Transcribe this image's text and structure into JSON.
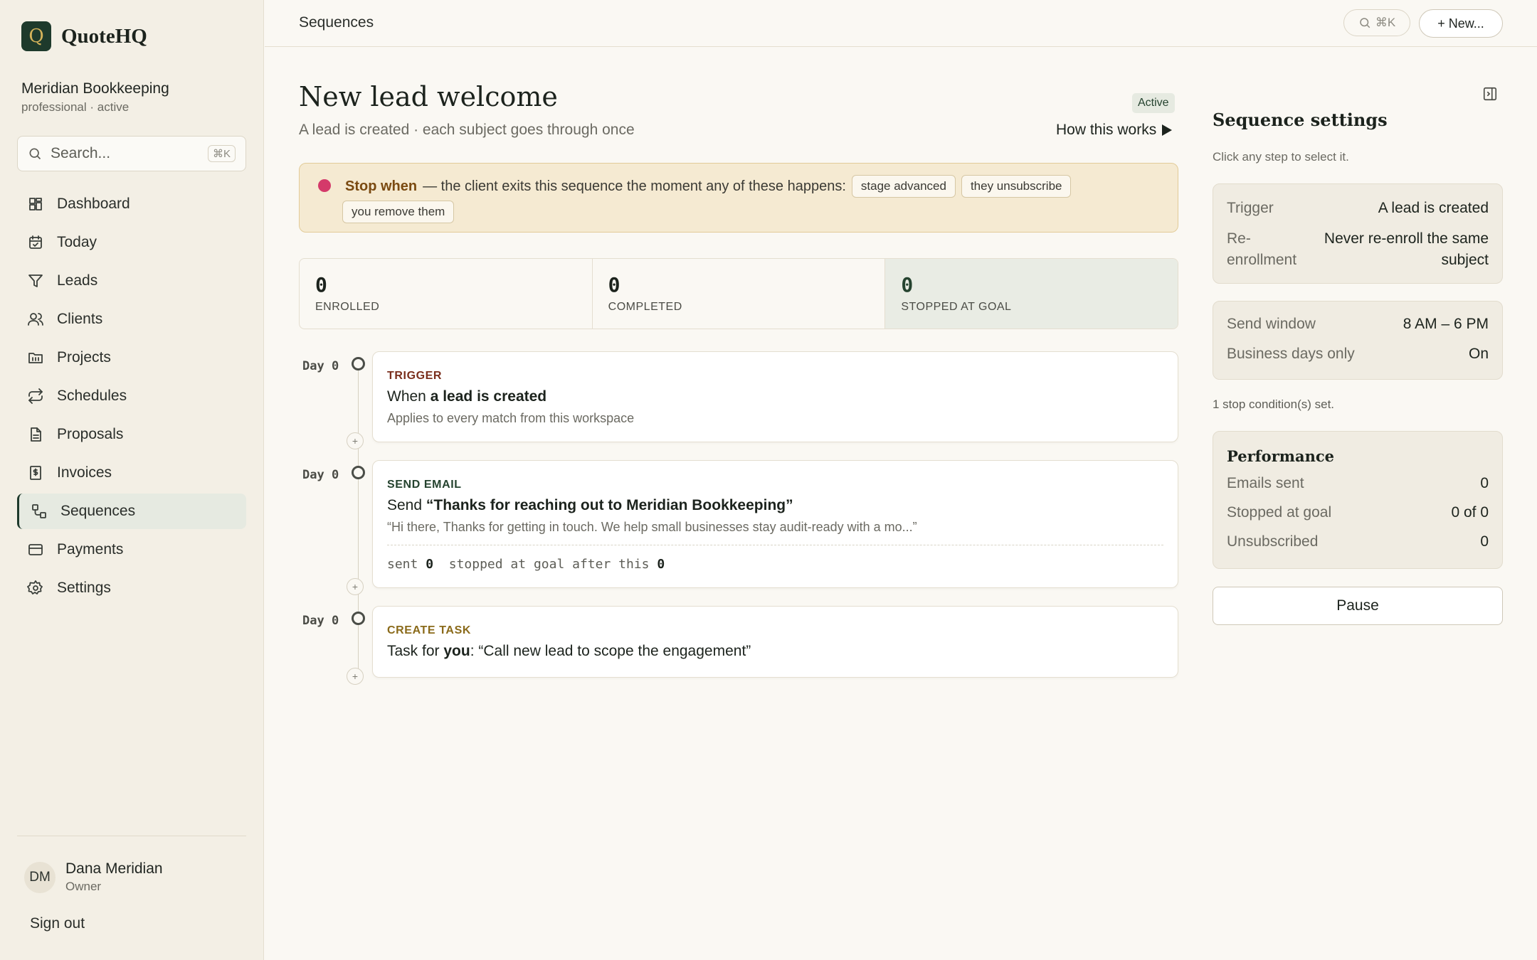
{
  "app": {
    "logo_letter": "Q",
    "name": "QuoteHQ"
  },
  "workspace": {
    "name": "Meridian Bookkeeping",
    "meta": "professional · active"
  },
  "sidebar": {
    "search_placeholder": "Search...",
    "search_shortcut": "⌘K",
    "items": [
      {
        "label": "Dashboard",
        "icon": "dashboard-icon"
      },
      {
        "label": "Today",
        "icon": "calendar-icon"
      },
      {
        "label": "Leads",
        "icon": "funnel-icon"
      },
      {
        "label": "Clients",
        "icon": "users-icon"
      },
      {
        "label": "Projects",
        "icon": "folder-icon"
      },
      {
        "label": "Schedules",
        "icon": "repeat-icon"
      },
      {
        "label": "Proposals",
        "icon": "document-icon"
      },
      {
        "label": "Invoices",
        "icon": "invoice-icon"
      },
      {
        "label": "Sequences",
        "icon": "sequence-icon",
        "active": true
      },
      {
        "label": "Payments",
        "icon": "card-icon"
      },
      {
        "label": "Settings",
        "icon": "gear-icon"
      }
    ],
    "user": {
      "initials": "DM",
      "name": "Dana Meridian",
      "role": "Owner"
    },
    "sign_out": "Sign out"
  },
  "topbar": {
    "breadcrumb": "Sequences",
    "search_shortcut": "⌘K",
    "new_label": "+ New..."
  },
  "sequence": {
    "title": "New lead welcome",
    "subtitle": "A lead is created · each subject goes through once",
    "status": "Active",
    "how_link": "How this works",
    "stop": {
      "label": "Stop when",
      "text": "— the client exits this sequence the moment any of these happens:",
      "conditions": [
        "stage advanced",
        "they unsubscribe",
        "you remove them"
      ]
    },
    "stats": [
      {
        "value": "0",
        "label": "ENROLLED"
      },
      {
        "value": "0",
        "label": "COMPLETED"
      },
      {
        "value": "0",
        "label": "STOPPED AT GOAL"
      }
    ],
    "steps": [
      {
        "day": "Day 0",
        "type": "TRIGGER",
        "title_prefix": "When ",
        "title_bold": "a lead is created",
        "title_suffix": "",
        "desc": "Applies to every match from this workspace"
      },
      {
        "day": "Day 0",
        "type": "SEND EMAIL",
        "title_prefix": "Send ",
        "title_bold": "“Thanks for reaching out to Meridian Bookkeeping”",
        "title_suffix": "",
        "desc": "“Hi there, Thanks for getting in touch. We help small businesses stay audit-ready with a mo...”",
        "stats": {
          "sent_label": "sent",
          "sent": "0",
          "stopped_label": "stopped at goal after this",
          "stopped": "0"
        }
      },
      {
        "day": "Day 0",
        "type": "CREATE TASK",
        "title_prefix": "Task for ",
        "title_bold": "you",
        "title_suffix": ": “Call new lead to scope the engagement”"
      }
    ],
    "add_step": "+"
  },
  "settings": {
    "title": "Sequence settings",
    "hint": "Click any step to select it.",
    "trigger_label": "Trigger",
    "trigger_value": "A lead is created",
    "reenroll_label": "Re-enrollment",
    "reenroll_value": "Never re-enroll the same subject",
    "send_window_label": "Send window",
    "send_window_value": "8 AM – 6 PM",
    "business_days_label": "Business days only",
    "business_days_value": "On",
    "stop_count": "1 stop condition(s) set.",
    "performance": {
      "title": "Performance",
      "rows": [
        {
          "label": "Emails sent",
          "value": "0"
        },
        {
          "label": "Stopped at goal",
          "value": "0 of 0"
        },
        {
          "label": "Unsubscribed",
          "value": "0"
        }
      ]
    },
    "pause_label": "Pause"
  },
  "colors": {
    "brand": "#1e3a2c",
    "accent_gold": "#d4b25a",
    "stop_dot": "#d43a6a",
    "trigger": "#7a2e1c",
    "email": "#25432f",
    "task": "#8a6a1a"
  }
}
